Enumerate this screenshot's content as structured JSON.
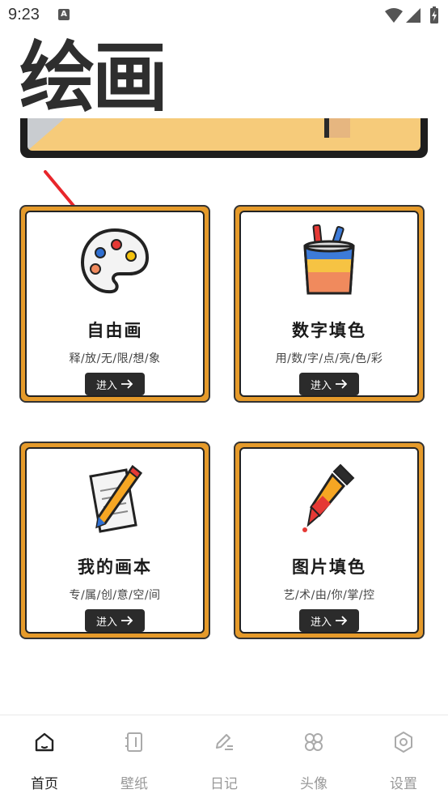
{
  "status_bar": {
    "time": "9:23",
    "notification_icon": "A"
  },
  "banner": {
    "title": "绘画"
  },
  "cards": [
    {
      "title": "自由画",
      "subtitle": "释/放/无/限/想/象",
      "button": "进入",
      "icon": "palette-icon"
    },
    {
      "title": "数字填色",
      "subtitle": "用/数/字/点/亮/色/彩",
      "button": "进入",
      "icon": "paint-cup-icon"
    },
    {
      "title": "我的画本",
      "subtitle": "专/属/创/意/空/间",
      "button": "进入",
      "icon": "notepad-pencil-icon"
    },
    {
      "title": "图片填色",
      "subtitle": "艺/术/由/你/掌/控",
      "button": "进入",
      "icon": "dropper-icon"
    }
  ],
  "bottom_nav": [
    {
      "label": "首页",
      "icon": "home-icon",
      "active": true
    },
    {
      "label": "壁纸",
      "icon": "notebook-icon",
      "active": false
    },
    {
      "label": "日记",
      "icon": "edit-icon",
      "active": false
    },
    {
      "label": "头像",
      "icon": "grid-icon",
      "active": false
    },
    {
      "label": "设置",
      "icon": "hexagon-settings-icon",
      "active": false
    }
  ],
  "colors": {
    "card_border": "#e59a2a",
    "banner_bg": "#f6cb7a",
    "button_bg": "#2b2b2b",
    "arrow": "#e8262b"
  }
}
